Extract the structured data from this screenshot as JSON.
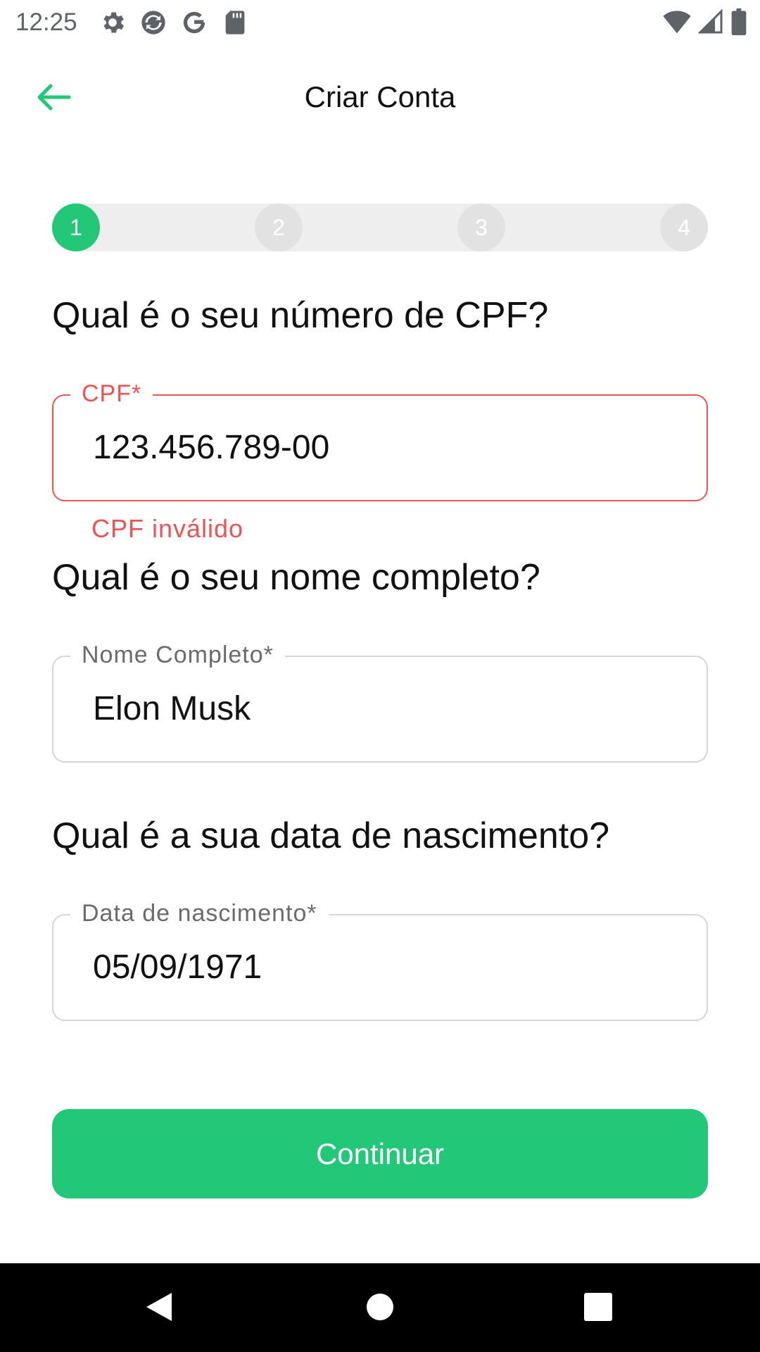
{
  "status_bar": {
    "time": "12:25",
    "left_icons": [
      "settings-icon",
      "sync-icon",
      "google-icon",
      "sd-card-icon"
    ],
    "right_icons": [
      "wifi-icon",
      "cellular-signal-icon",
      "battery-icon"
    ]
  },
  "app_bar": {
    "title": "Criar Conta",
    "back_icon": "arrow-left-icon"
  },
  "stepper": {
    "steps": [
      {
        "label": "1",
        "active": true
      },
      {
        "label": "2",
        "active": false
      },
      {
        "label": "3",
        "active": false
      },
      {
        "label": "4",
        "active": false
      }
    ]
  },
  "form": {
    "cpf": {
      "question": "Qual é o seu número de CPF?",
      "label": "CPF*",
      "value": "123.456.789-00",
      "error": "CPF inválido"
    },
    "name": {
      "question": "Qual é o seu nome completo?",
      "label": "Nome Completo*",
      "value": "Elon Musk"
    },
    "birthdate": {
      "question": "Qual é a sua data de nascimento?",
      "label": "Data de nascimento*",
      "value": "05/09/1971"
    }
  },
  "actions": {
    "continue_label": "Continuar"
  },
  "nav_bar": {
    "buttons": [
      "nav-back-icon",
      "nav-home-icon",
      "nav-recents-icon"
    ]
  },
  "colors": {
    "accent": "#22c778",
    "error": "#ee5253",
    "stepper_track": "#eeeeee",
    "inactive_step": "#e2e2e2"
  }
}
